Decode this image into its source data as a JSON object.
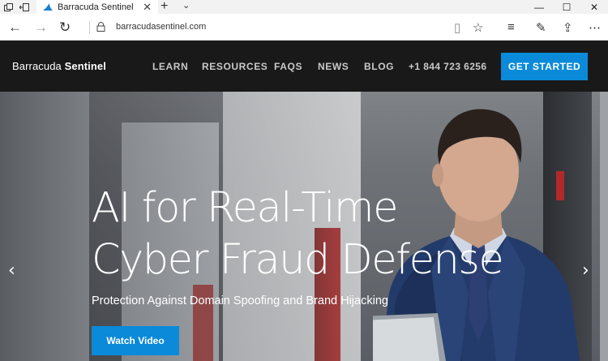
{
  "browser": {
    "tab_title": "Barracuda Sentinel",
    "tab_close": "✕",
    "new_tab": "+",
    "tab_list": "⌄",
    "win_min": "—",
    "win_max": "☐",
    "win_close": "✕",
    "back": "←",
    "forward": "→",
    "refresh": "↻",
    "url": "barracudasentinel.com",
    "reading_view": "▯",
    "favorite": "☆",
    "hub": "≡",
    "web_note": "✎",
    "share": "⇪",
    "more": "⋯"
  },
  "site": {
    "logo_light": "Barracuda ",
    "logo_bold": "Sentinel",
    "nav": [
      "LEARN",
      "RESOURCES",
      "FAQS",
      "NEWS",
      "BLOG"
    ],
    "phone": "+1 844 723 6256",
    "cta": "GET STARTED",
    "headline_line1": "AI for Real-Time",
    "headline_line2": "Cyber Fraud Defense",
    "subheadline": "Protection Against Domain Spoofing and Brand Hijacking",
    "watch_video": "Watch Video",
    "prev_arrow": "‹",
    "next_arrow": "›"
  },
  "colors": {
    "accent": "#0a8ad9",
    "nav_bg": "#191919",
    "brand_fin": "#1a7fd4"
  }
}
